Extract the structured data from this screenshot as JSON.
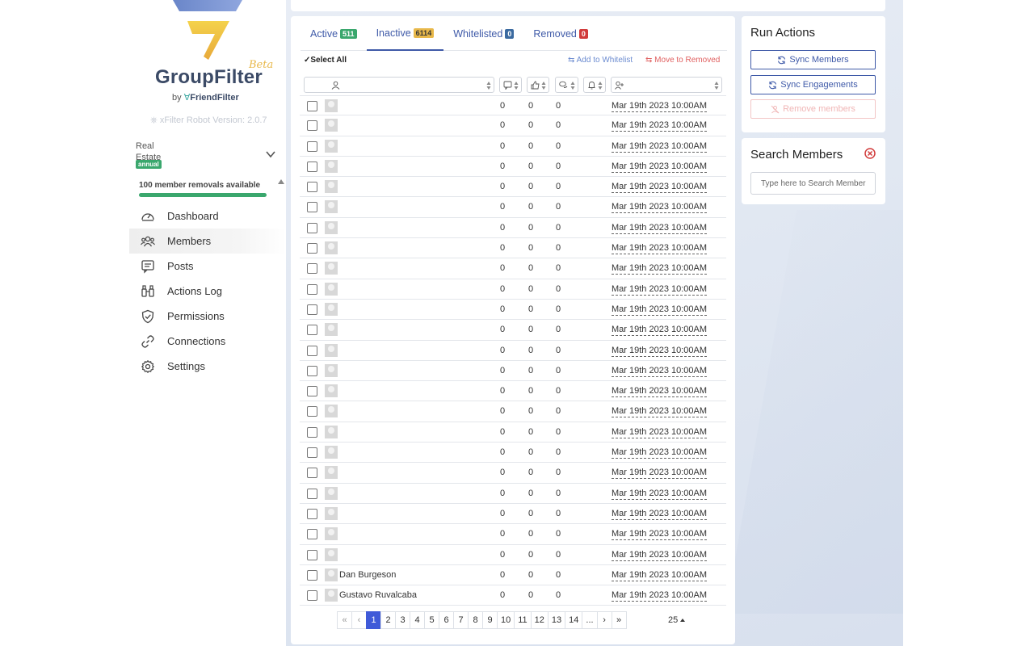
{
  "brand": {
    "name": "GroupFilter",
    "beta": "Beta",
    "by": "by",
    "by_brand": "FriendFilter",
    "robot_version": "xFilter Robot Version: 2.0.7"
  },
  "group": {
    "image_alt": "Real Estate",
    "plan_badge": "annual"
  },
  "removals": {
    "text": "100 member removals available",
    "fill_fraction": 1.0
  },
  "nav": [
    {
      "label": "Dashboard",
      "icon": "gauge-icon",
      "active": false
    },
    {
      "label": "Members",
      "icon": "users-icon",
      "active": true
    },
    {
      "label": "Posts",
      "icon": "message-icon",
      "active": false
    },
    {
      "label": "Actions Log",
      "icon": "binoculars-icon",
      "active": false
    },
    {
      "label": "Permissions",
      "icon": "shield-check-icon",
      "active": false
    },
    {
      "label": "Connections",
      "icon": "link-icon",
      "active": false
    },
    {
      "label": "Settings",
      "icon": "gear-icon",
      "active": false
    }
  ],
  "tabs": [
    {
      "label": "Active",
      "count": "511",
      "color": "#3aa76d"
    },
    {
      "label": "Inactive",
      "count": "6114",
      "color": "#e8b84a"
    },
    {
      "label": "Whitelisted",
      "count": "0",
      "color": "#3b6aa0"
    },
    {
      "label": "Removed",
      "count": "0",
      "color": "#d13b3b"
    }
  ],
  "toolbar": {
    "select_all": "Select All",
    "add_whitelist": "Add to Whitelist",
    "move_removed": "Move to Removed"
  },
  "rows": [
    {
      "name": "",
      "c1": "0",
      "c2": "0",
      "c3": "0",
      "date": "Mar 19th 2023 10:00AM"
    },
    {
      "name": "",
      "c1": "0",
      "c2": "0",
      "c3": "0",
      "date": "Mar 19th 2023 10:00AM"
    },
    {
      "name": "",
      "c1": "0",
      "c2": "0",
      "c3": "0",
      "date": "Mar 19th 2023 10:00AM"
    },
    {
      "name": "",
      "c1": "0",
      "c2": "0",
      "c3": "0",
      "date": "Mar 19th 2023 10:00AM"
    },
    {
      "name": "",
      "c1": "0",
      "c2": "0",
      "c3": "0",
      "date": "Mar 19th 2023 10:00AM"
    },
    {
      "name": "",
      "c1": "0",
      "c2": "0",
      "c3": "0",
      "date": "Mar 19th 2023 10:00AM"
    },
    {
      "name": "",
      "c1": "0",
      "c2": "0",
      "c3": "0",
      "date": "Mar 19th 2023 10:00AM"
    },
    {
      "name": "",
      "c1": "0",
      "c2": "0",
      "c3": "0",
      "date": "Mar 19th 2023 10:00AM"
    },
    {
      "name": "",
      "c1": "0",
      "c2": "0",
      "c3": "0",
      "date": "Mar 19th 2023 10:00AM"
    },
    {
      "name": "",
      "c1": "0",
      "c2": "0",
      "c3": "0",
      "date": "Mar 19th 2023 10:00AM"
    },
    {
      "name": "",
      "c1": "0",
      "c2": "0",
      "c3": "0",
      "date": "Mar 19th 2023 10:00AM"
    },
    {
      "name": "",
      "c1": "0",
      "c2": "0",
      "c3": "0",
      "date": "Mar 19th 2023 10:00AM"
    },
    {
      "name": "",
      "c1": "0",
      "c2": "0",
      "c3": "0",
      "date": "Mar 19th 2023 10:00AM"
    },
    {
      "name": "",
      "c1": "0",
      "c2": "0",
      "c3": "0",
      "date": "Mar 19th 2023 10:00AM"
    },
    {
      "name": "",
      "c1": "0",
      "c2": "0",
      "c3": "0",
      "date": "Mar 19th 2023 10:00AM"
    },
    {
      "name": "",
      "c1": "0",
      "c2": "0",
      "c3": "0",
      "date": "Mar 19th 2023 10:00AM"
    },
    {
      "name": "",
      "c1": "0",
      "c2": "0",
      "c3": "0",
      "date": "Mar 19th 2023 10:00AM"
    },
    {
      "name": "",
      "c1": "0",
      "c2": "0",
      "c3": "0",
      "date": "Mar 19th 2023 10:00AM"
    },
    {
      "name": "",
      "c1": "0",
      "c2": "0",
      "c3": "0",
      "date": "Mar 19th 2023 10:00AM"
    },
    {
      "name": "",
      "c1": "0",
      "c2": "0",
      "c3": "0",
      "date": "Mar 19th 2023 10:00AM"
    },
    {
      "name": "",
      "c1": "0",
      "c2": "0",
      "c3": "0",
      "date": "Mar 19th 2023 10:00AM"
    },
    {
      "name": "",
      "c1": "0",
      "c2": "0",
      "c3": "0",
      "date": "Mar 19th 2023 10:00AM"
    },
    {
      "name": "",
      "c1": "0",
      "c2": "0",
      "c3": "0",
      "date": "Mar 19th 2023 10:00AM"
    },
    {
      "name": "Dan Burgeson",
      "c1": "0",
      "c2": "0",
      "c3": "0",
      "date": "Mar 19th 2023 10:00AM"
    },
    {
      "name": "Gustavo Ruvalcaba",
      "c1": "0",
      "c2": "0",
      "c3": "0",
      "date": "Mar 19th 2023 10:00AM"
    }
  ],
  "pager": {
    "first": "«",
    "prev": "‹",
    "pages": [
      "1",
      "2",
      "3",
      "4",
      "5",
      "6",
      "7",
      "8",
      "9",
      "10",
      "11",
      "12",
      "13",
      "14"
    ],
    "ellipsis": "...",
    "next": "›",
    "last": "»",
    "current": "1",
    "per_page": "25"
  },
  "run_actions": {
    "title": "Run Actions",
    "sync_members": "Sync Members",
    "sync_engagements": "Sync Engagements",
    "remove_members": "Remove members"
  },
  "search": {
    "title": "Search Members",
    "placeholder": "Type here to Search Member"
  }
}
